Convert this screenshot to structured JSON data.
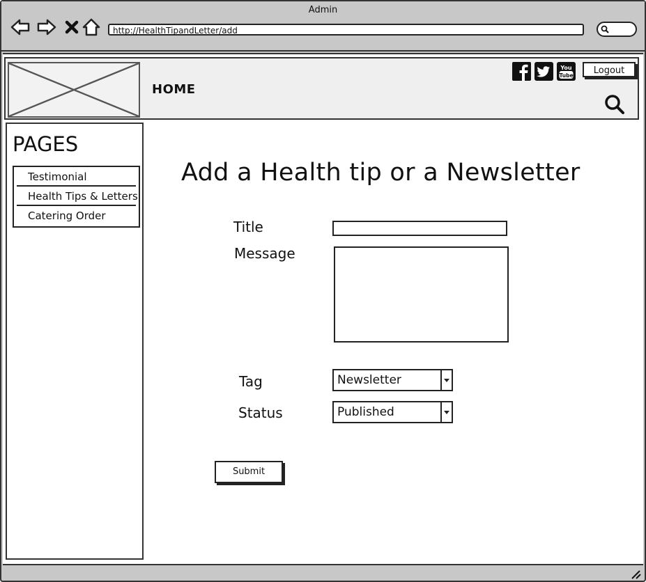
{
  "window": {
    "title": "Admin"
  },
  "browser": {
    "url": "http://HealthTipandLetter/add",
    "icons": [
      "back-arrow-icon",
      "forward-arrow-icon",
      "close-icon",
      "home-icon",
      "search-icon"
    ]
  },
  "header": {
    "home_label": "HOME",
    "logout_label": "Logout",
    "social_icons": [
      "facebook-icon",
      "twitter-icon",
      "youtube-icon"
    ]
  },
  "sidebar": {
    "title": "PAGES",
    "items": [
      {
        "label": "Testimonial"
      },
      {
        "label": "Health Tips & Letters"
      },
      {
        "label": "Catering Order"
      }
    ]
  },
  "form": {
    "heading": "Add a Health tip or a Newsletter",
    "title_label": "Title",
    "title_value": "",
    "message_label": "Message",
    "message_value": "",
    "tag_label": "Tag",
    "tag_selected": "Newsletter",
    "status_label": "Status",
    "status_selected": "Published",
    "submit_label": "Submit"
  }
}
